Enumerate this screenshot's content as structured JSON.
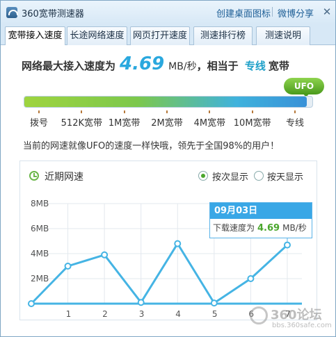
{
  "app": {
    "title": "360宽带测速器",
    "links": {
      "desktop_icon": "创建桌面图标",
      "weibo_share": "微博分享"
    },
    "close_glyph": "✕"
  },
  "tabs": [
    {
      "label": "宽带接入速度",
      "active": true
    },
    {
      "label": "长途网络速度",
      "active": false
    },
    {
      "label": "网页打开速度",
      "active": false
    },
    {
      "label": "测速排行榜",
      "active": false
    },
    {
      "label": "测速说明",
      "active": false
    }
  ],
  "result": {
    "prefix": "网络最大接入速度为",
    "speed": "4.69",
    "unit": "MB/秒",
    "equivalent_prefix": "，相当于",
    "tier": "专线",
    "suffix": "宽带"
  },
  "bandwidth_scale": {
    "badge": "UFO",
    "level_fraction": 0.98,
    "ticks": [
      "拨号",
      "512K宽带",
      "1M宽带",
      "2M宽带",
      "4M宽带",
      "10M宽带",
      "专线"
    ]
  },
  "comparison_text": "当前的网速就像UFO的速度一样快哦，领先于全国98%的用户！",
  "chart_panel": {
    "title": "近期网速",
    "radio_by_count": "按次显示",
    "radio_by_day": "按天显示",
    "selected": "by_count"
  },
  "tooltip": {
    "date": "09月03日",
    "label": "下载速度为",
    "value": "4.69",
    "unit": "MB/秒"
  },
  "chart_data": {
    "type": "line",
    "title": "近期网速",
    "x": [
      0,
      1,
      2,
      3,
      4,
      5,
      6,
      7
    ],
    "y": [
      0,
      3.0,
      3.9,
      0.1,
      4.8,
      0.05,
      2.0,
      4.69
    ],
    "x_tick_labels": [
      "1",
      "2",
      "3",
      "4",
      "5",
      "6",
      "7"
    ],
    "y_tick_labels": [
      "2MB",
      "4MB",
      "6MB",
      "8MB"
    ],
    "ylim": [
      0,
      8
    ],
    "xlim": [
      0,
      7.4
    ],
    "grid": true,
    "colors": {
      "line": "#45b4e4",
      "grid": "#e3e8ee"
    }
  },
  "watermark": {
    "main": "360论坛",
    "sub": "bbs.360safe.com"
  }
}
